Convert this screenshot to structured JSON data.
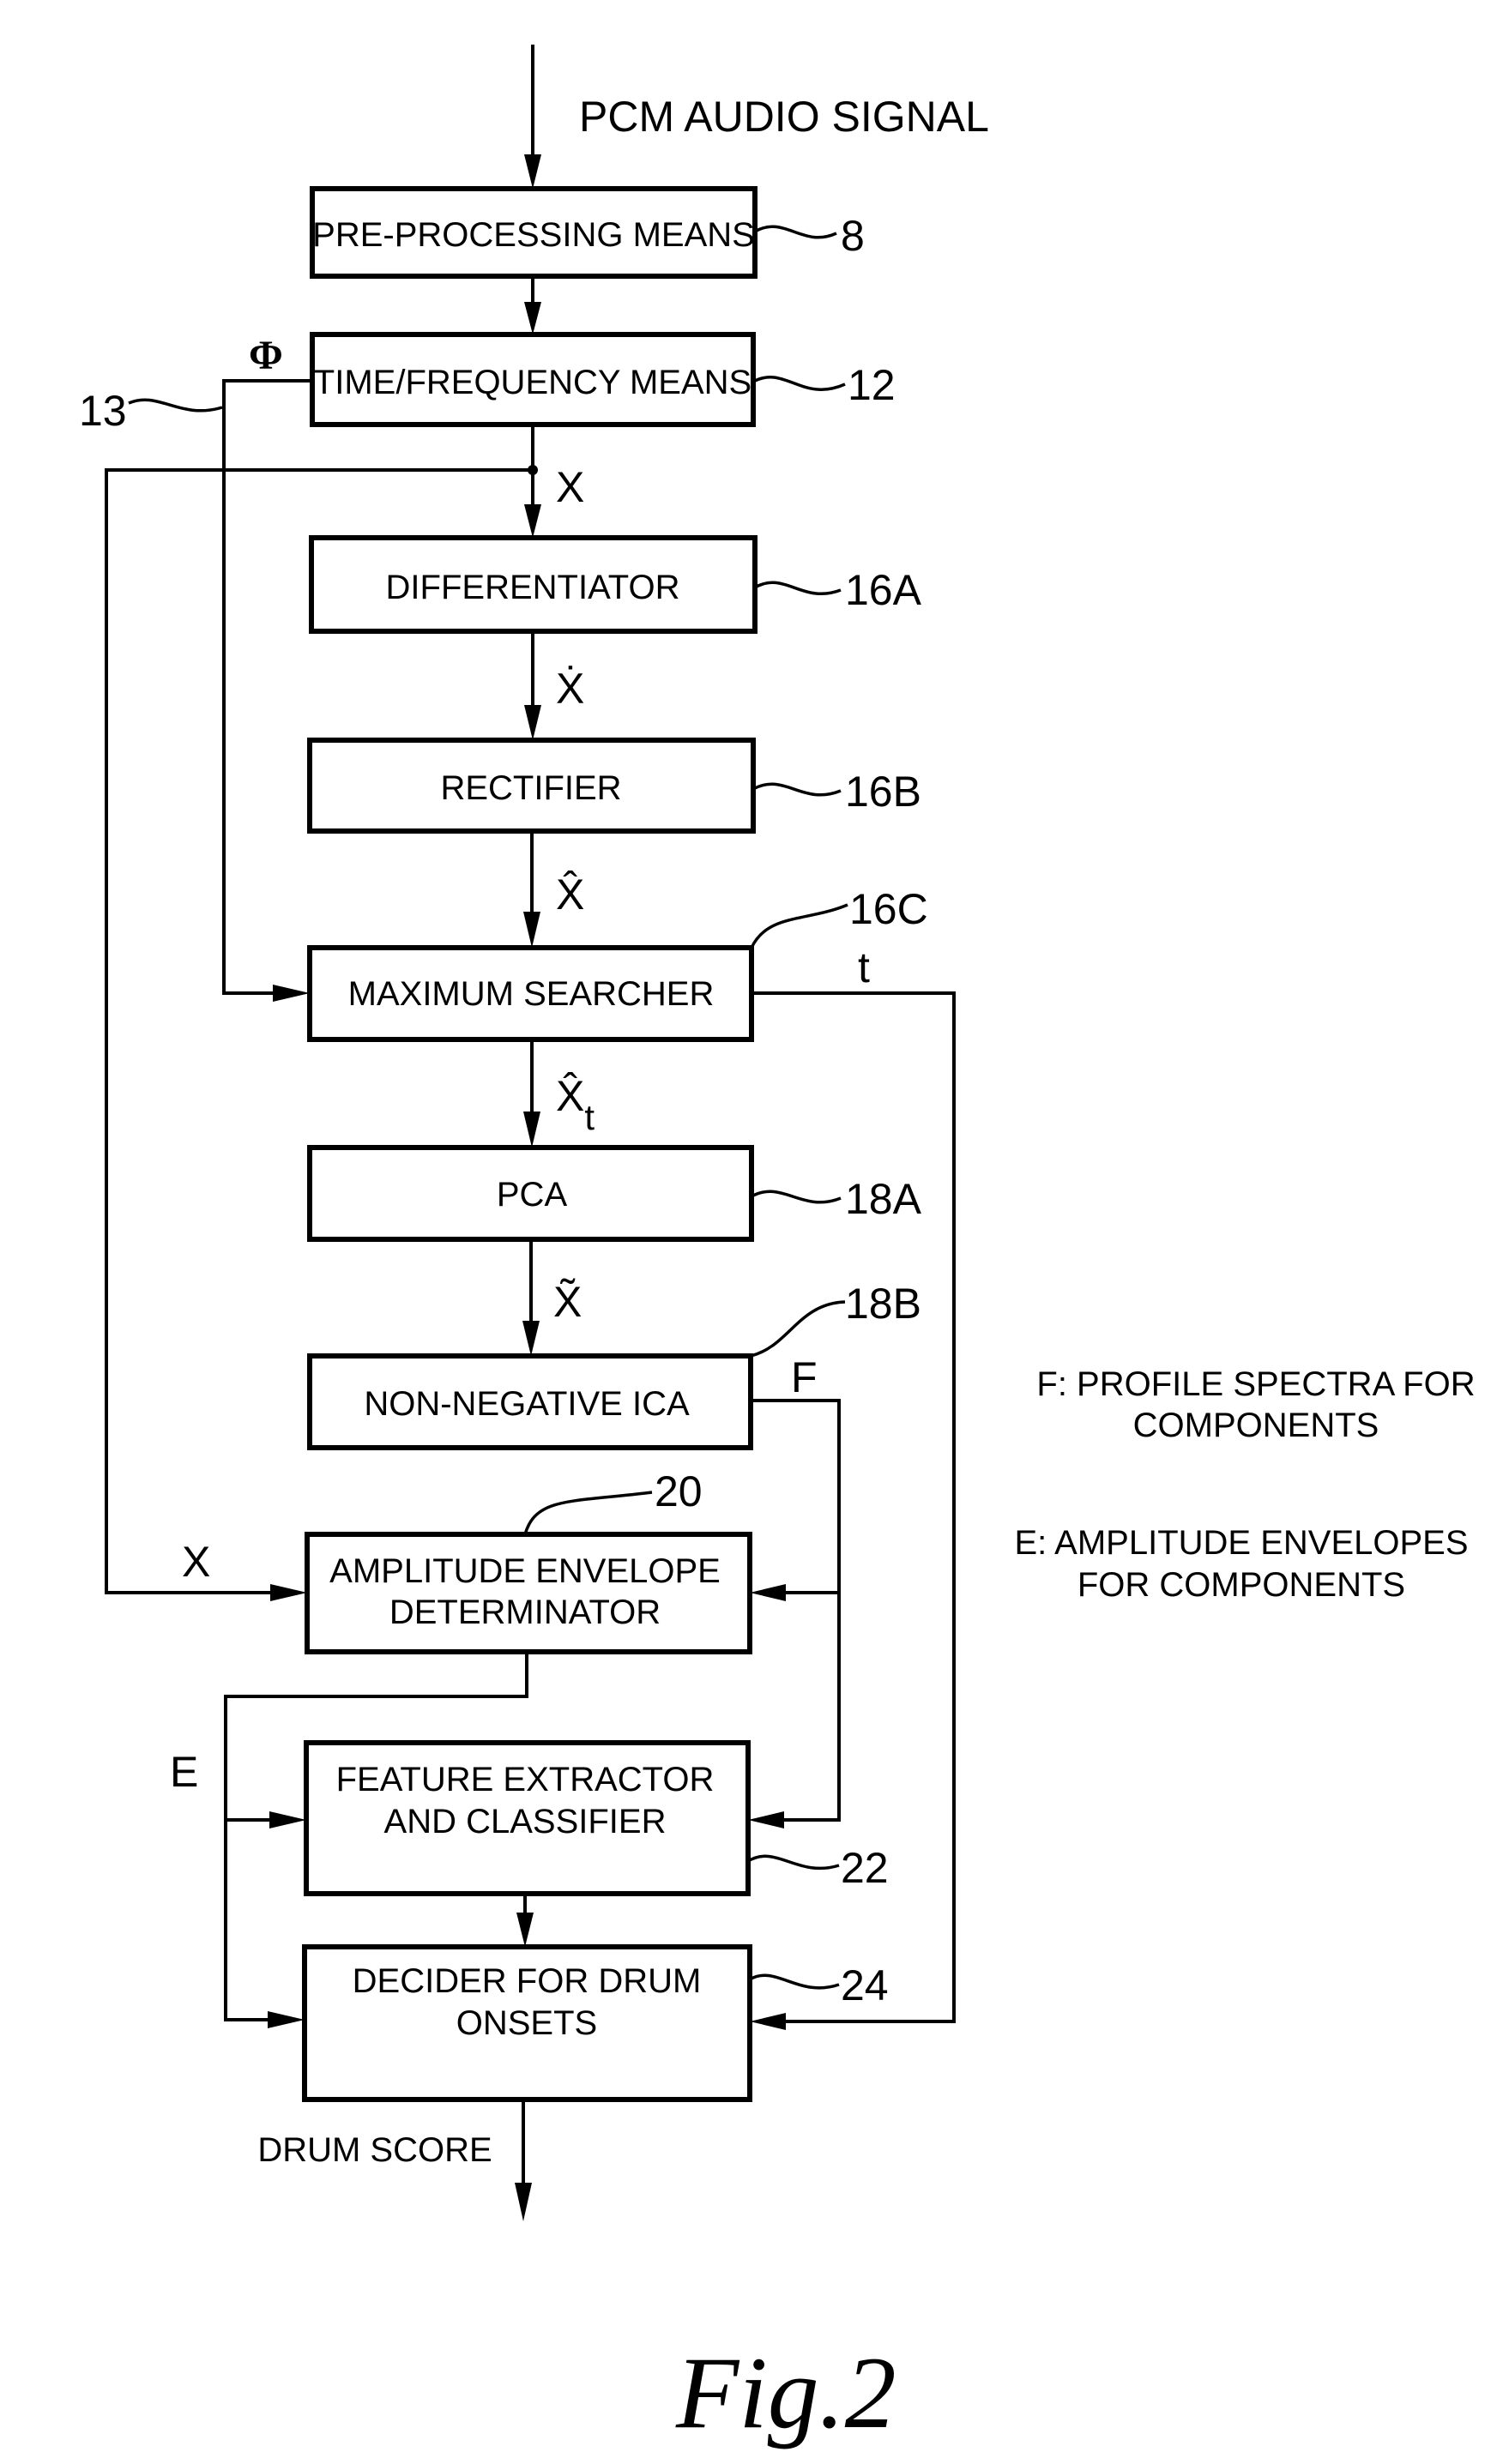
{
  "figure": {
    "label": "Fig.2",
    "input_label": "PCM AUDIO SIGNAL",
    "output_label": "DRUM SCORE"
  },
  "blocks": [
    {
      "id": "pre_processing",
      "lines": [
        "PRE-PROCESSING MEANS"
      ],
      "ref": "8"
    },
    {
      "id": "time_frequency",
      "lines": [
        "TIME/FREQUENCY MEANS"
      ],
      "ref": "12"
    },
    {
      "id": "differentiator",
      "lines": [
        "DIFFERENTIATOR"
      ],
      "ref": "16A"
    },
    {
      "id": "rectifier",
      "lines": [
        "RECTIFIER"
      ],
      "ref": "16B"
    },
    {
      "id": "maximum_searcher",
      "lines": [
        "MAXIMUM SEARCHER"
      ],
      "ref": "16C"
    },
    {
      "id": "pca",
      "lines": [
        "PCA"
      ],
      "ref": "18A"
    },
    {
      "id": "nn_ica",
      "lines": [
        "NON-NEGATIVE ICA"
      ],
      "ref": "18B"
    },
    {
      "id": "amp_env",
      "lines": [
        "AMPLITUDE ENVELOPE",
        "DETERMINATOR"
      ],
      "ref": "20"
    },
    {
      "id": "feature",
      "lines": [
        "FEATURE EXTRACTOR",
        "AND CLASSIFIER"
      ],
      "ref": "22"
    },
    {
      "id": "decider",
      "lines": [
        "DECIDER FOR DRUM",
        "ONSETS"
      ],
      "ref": "24"
    }
  ],
  "signals": {
    "phi": "Φ",
    "phi_ref": "13",
    "x": "X",
    "x_dot": "Ẋ",
    "x_hat": "X̂",
    "x_hat_t": "X̂",
    "x_hat_t_sub": "t",
    "x_tilde": "X̃",
    "t": "t",
    "f": "F",
    "x_left": "X",
    "e": "E"
  },
  "legend": {
    "f_note": [
      "F: PROFILE SPECTRA FOR",
      "COMPONENTS"
    ],
    "e_note": [
      "E: AMPLITUDE ENVELOPES",
      "FOR COMPONENTS"
    ]
  }
}
